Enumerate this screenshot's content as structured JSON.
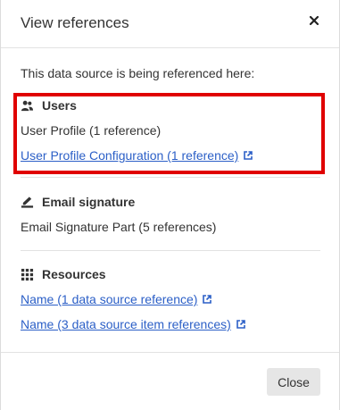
{
  "dialog": {
    "title": "View references",
    "close_icon": "close-icon",
    "intro": "This data source is being referenced here:",
    "close_button_label": "Close"
  },
  "sections": [
    {
      "icon": "users-icon",
      "heading": "Users",
      "text": "User Profile (1 reference)",
      "link": "User Profile Configuration (1 reference)"
    },
    {
      "icon": "signature-icon",
      "heading": "Email signature",
      "text": "Email Signature Part (5 references)"
    },
    {
      "icon": "resources-icon",
      "heading": "Resources",
      "links": [
        "Name (1 data source reference)",
        "Name (3 data source item references)"
      ]
    }
  ],
  "colors": {
    "link": "#2b5fc7",
    "highlight": "#e00000",
    "button_bg": "#e6e6e6"
  }
}
